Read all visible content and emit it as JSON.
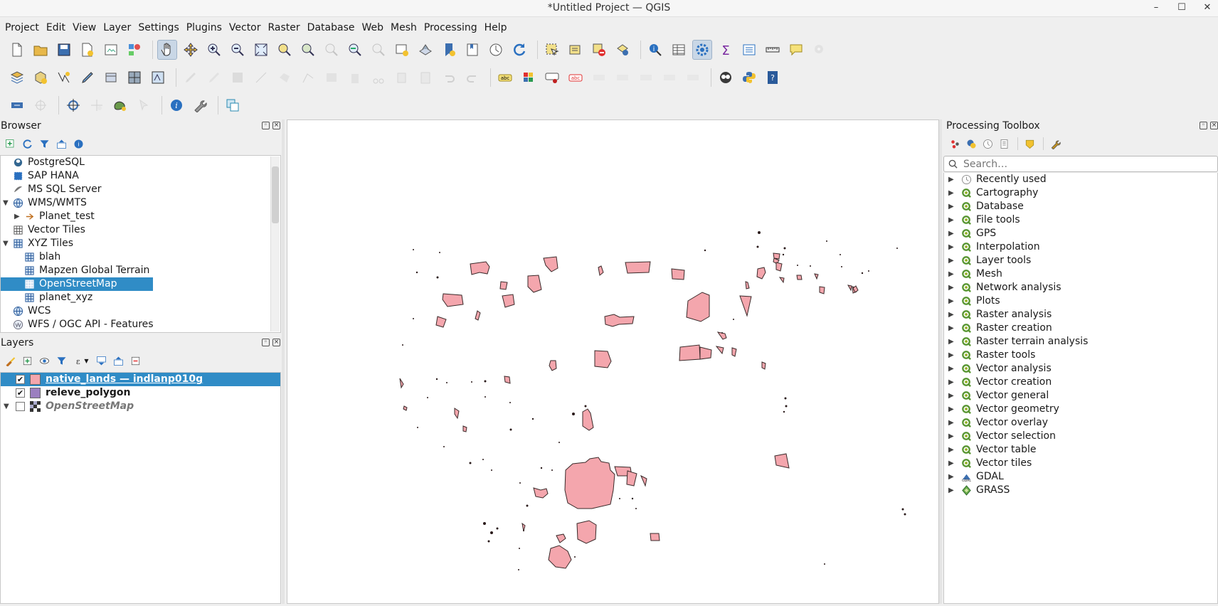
{
  "window": {
    "title": "*Untitled Project — QGIS",
    "minimize": "–",
    "maximize": "☐",
    "close": "✕"
  },
  "menu": [
    "Project",
    "Edit",
    "View",
    "Layer",
    "Settings",
    "Plugins",
    "Vector",
    "Raster",
    "Database",
    "Web",
    "Mesh",
    "Processing",
    "Help"
  ],
  "browser": {
    "title": "Browser",
    "items": [
      {
        "label": "PostgreSQL",
        "icon": "postgresql-icon"
      },
      {
        "label": "SAP HANA",
        "icon": "sap-hana-icon"
      },
      {
        "label": "MS SQL Server",
        "icon": "mssql-icon"
      },
      {
        "label": "WMS/WMTS",
        "icon": "globe-icon",
        "expanded": true
      },
      {
        "label": "Planet_test",
        "icon": "planet-icon"
      },
      {
        "label": "Vector Tiles",
        "icon": "vector-tiles-icon"
      },
      {
        "label": "XYZ Tiles",
        "icon": "xyz-tiles-icon",
        "expanded": true
      },
      {
        "label": "blah",
        "icon": "tile-grid-icon"
      },
      {
        "label": "Mapzen Global Terrain",
        "icon": "tile-grid-icon"
      },
      {
        "label": "OpenStreetMap",
        "icon": "tile-grid-icon",
        "selected": true
      },
      {
        "label": "planet_xyz",
        "icon": "tile-grid-icon"
      },
      {
        "label": "WCS",
        "icon": "globe-icon"
      },
      {
        "label": "WFS / OGC API - Features",
        "icon": "wfs-icon"
      }
    ]
  },
  "layers": {
    "title": "Layers",
    "items": [
      {
        "name": "native_lands — indlanp010g",
        "checked": "✔",
        "color": "#f4a6ad",
        "selected": true
      },
      {
        "name": "releve_polygon",
        "checked": "✔",
        "color": "#9b7fc0"
      },
      {
        "name": "OpenStreetMap",
        "checked": "",
        "color": "raster",
        "italic": true
      }
    ]
  },
  "processing": {
    "title": "Processing Toolbox",
    "search_placeholder": "Search…",
    "items": [
      {
        "label": "Recently used",
        "icon": "clock-icon"
      },
      {
        "label": "Cartography",
        "icon": "qgis-icon"
      },
      {
        "label": "Database",
        "icon": "qgis-icon"
      },
      {
        "label": "File tools",
        "icon": "qgis-icon"
      },
      {
        "label": "GPS",
        "icon": "qgis-icon"
      },
      {
        "label": "Interpolation",
        "icon": "qgis-icon"
      },
      {
        "label": "Layer tools",
        "icon": "qgis-icon"
      },
      {
        "label": "Mesh",
        "icon": "qgis-icon"
      },
      {
        "label": "Network analysis",
        "icon": "qgis-icon"
      },
      {
        "label": "Plots",
        "icon": "qgis-icon"
      },
      {
        "label": "Raster analysis",
        "icon": "qgis-icon"
      },
      {
        "label": "Raster creation",
        "icon": "qgis-icon"
      },
      {
        "label": "Raster terrain analysis",
        "icon": "qgis-icon"
      },
      {
        "label": "Raster tools",
        "icon": "qgis-icon"
      },
      {
        "label": "Vector analysis",
        "icon": "qgis-icon"
      },
      {
        "label": "Vector creation",
        "icon": "qgis-icon"
      },
      {
        "label": "Vector general",
        "icon": "qgis-icon"
      },
      {
        "label": "Vector geometry",
        "icon": "qgis-icon"
      },
      {
        "label": "Vector overlay",
        "icon": "qgis-icon"
      },
      {
        "label": "Vector selection",
        "icon": "qgis-icon"
      },
      {
        "label": "Vector table",
        "icon": "qgis-icon"
      },
      {
        "label": "Vector tiles",
        "icon": "qgis-icon"
      },
      {
        "label": "GDAL",
        "icon": "gdal-icon"
      },
      {
        "label": "GRASS",
        "icon": "grass-icon"
      }
    ]
  },
  "colors": {
    "selection": "#308cc6",
    "polygon_fill": "#f4a6ad",
    "polygon_stroke": "#3a2a2a"
  }
}
